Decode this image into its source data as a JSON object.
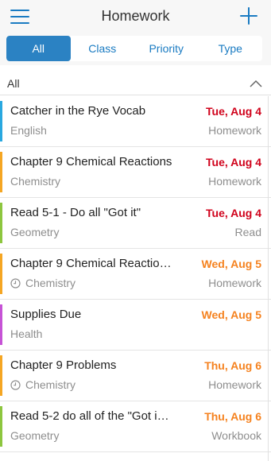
{
  "header": {
    "title": "Homework",
    "menu_icon": "hamburger-menu-icon",
    "add_icon": "plus-icon"
  },
  "filters": {
    "tabs": [
      {
        "label": "All",
        "active": true
      },
      {
        "label": "Class",
        "active": false
      },
      {
        "label": "Priority",
        "active": false
      },
      {
        "label": "Type",
        "active": false
      }
    ]
  },
  "section": {
    "label": "All",
    "collapse_icon": "chevron-up-icon"
  },
  "colors": {
    "accent": "#1a7bc2",
    "overdue": "#d0021b",
    "upcoming": "#f5821f"
  },
  "assignments": [
    {
      "title": "Catcher in the Rye Vocab",
      "subject": "English",
      "due": "Tue, Aug 4",
      "type": "Homework",
      "has_reminder": false,
      "class_color": "#29a8e0",
      "due_color": "#d0021b"
    },
    {
      "title": "Chapter 9 Chemical Reactions",
      "subject": "Chemistry",
      "due": "Tue, Aug 4",
      "type": "Homework",
      "has_reminder": false,
      "class_color": "#f5a623",
      "due_color": "#d0021b"
    },
    {
      "title": "Read 5-1 - Do all \"Got it\"",
      "subject": "Geometry",
      "due": "Tue, Aug 4",
      "type": "Read",
      "has_reminder": false,
      "class_color": "#8dc63f",
      "due_color": "#d0021b"
    },
    {
      "title": "Chapter 9 Chemical Reactio…",
      "subject": "Chemistry",
      "due": "Wed, Aug 5",
      "type": "Homework",
      "has_reminder": true,
      "class_color": "#f5a623",
      "due_color": "#f5821f"
    },
    {
      "title": "Supplies Due",
      "subject": "Health",
      "due": "Wed, Aug 5",
      "type": "",
      "has_reminder": false,
      "class_color": "#c653d6",
      "due_color": "#f5821f"
    },
    {
      "title": "Chapter 9 Problems",
      "subject": "Chemistry",
      "due": "Thu, Aug 6",
      "type": "Homework",
      "has_reminder": true,
      "class_color": "#f5a623",
      "due_color": "#f5821f"
    },
    {
      "title": "Read 5-2 do all of the \"Got i…",
      "subject": "Geometry",
      "due": "Thu, Aug 6",
      "type": "Workbook",
      "has_reminder": false,
      "class_color": "#8dc63f",
      "due_color": "#f5821f"
    }
  ]
}
